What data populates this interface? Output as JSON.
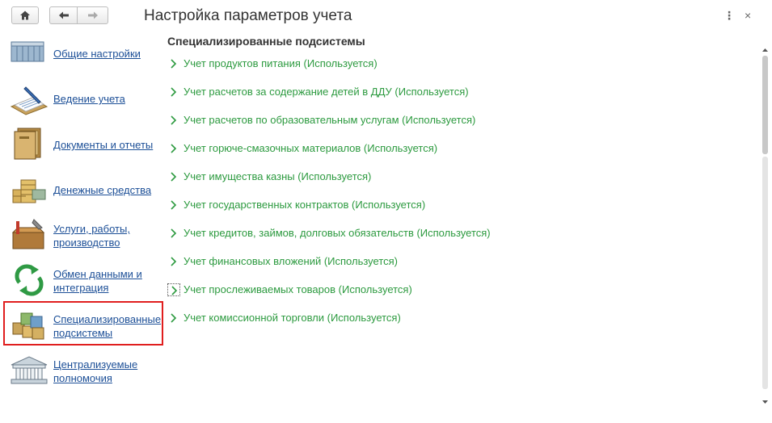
{
  "window": {
    "title": "Настройка параметров учета",
    "more_label": "⋮",
    "close_label": "×"
  },
  "sidebar": {
    "items": [
      {
        "label": "Общие настройки",
        "icon": "building-icon"
      },
      {
        "label": "Ведение учета",
        "icon": "ledger-pen-icon"
      },
      {
        "label": "Документы и отчеты",
        "icon": "documents-icon"
      },
      {
        "label": "Денежные средства",
        "icon": "coins-icon"
      },
      {
        "label": "Услуги, работы,\nпроизводство",
        "icon": "toolbox-icon"
      },
      {
        "label": "Обмен данными и\nинтеграция",
        "icon": "sync-icon"
      },
      {
        "label": "Специализированные\nподсистемы",
        "icon": "cubes-icon"
      },
      {
        "label": "Централизуемые\nполномочия",
        "icon": "institution-icon"
      }
    ],
    "selected_index": 6
  },
  "main": {
    "section_title": "Специализированные подсистемы",
    "subsystems": [
      "Учет продуктов питания (Используется)",
      "Учет расчетов за содержание детей в ДДУ (Используется)",
      "Учет расчетов по образовательным услугам (Используется)",
      "Учет горюче-смазочных материалов (Используется)",
      "Учет имущества казны (Используется)",
      "Учет государственных контрактов (Используется)",
      "Учет кредитов, займов, долговых обязательств (Используется)",
      "Учет финансовых вложений (Используется)",
      "Учет прослеживаемых товаров (Используется)",
      "Учет комиссионной торговли (Используется)"
    ],
    "focused_index": 8
  },
  "colors": {
    "link": "#1c4f97",
    "subsystem_text": "#2c9a3f",
    "selection_border": "#e01e1e"
  }
}
